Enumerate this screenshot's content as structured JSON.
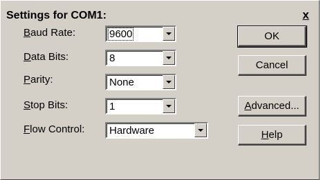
{
  "dialog": {
    "title": "Settings for COM1:",
    "close_glyph": "x"
  },
  "fields": [
    {
      "label_prefix": "",
      "label_accel": "B",
      "label_rest": "aud Rate:",
      "value": "9600"
    },
    {
      "label_prefix": "",
      "label_accel": "D",
      "label_rest": "ata Bits:",
      "value": "8"
    },
    {
      "label_prefix": "",
      "label_accel": "P",
      "label_rest": "arity:",
      "value": "None"
    },
    {
      "label_prefix": "",
      "label_accel": "S",
      "label_rest": "top Bits:",
      "value": "1"
    },
    {
      "label_prefix": "",
      "label_accel": "F",
      "label_rest": "low Control:",
      "value": "Hardware"
    }
  ],
  "buttons": {
    "ok": {
      "label": "OK"
    },
    "cancel": {
      "label": "Cancel"
    },
    "advanced": {
      "label_accel": "A",
      "label_rest": "dvanced..."
    },
    "help": {
      "label_accel": "H",
      "label_rest": "elp"
    }
  },
  "icons": {
    "dropdown_arrow": "chevron-down-icon",
    "close": "close-icon"
  }
}
